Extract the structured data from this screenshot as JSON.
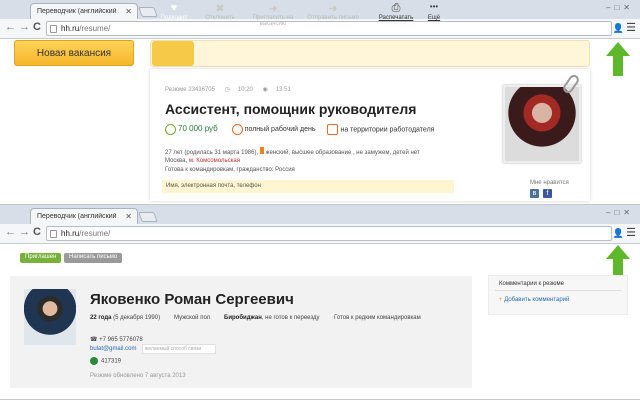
{
  "browser": {
    "tab_title": "Переводчик (английский я",
    "tab_close": "✕",
    "window_controls": "–□✕",
    "url_host": "hh.ru",
    "url_path": "/resume/",
    "back": "←",
    "forward": "→",
    "reload": "C",
    "ext_icon": "👤",
    "menu": "☰"
  },
  "colors": {
    "arrow": "#5fb82c",
    "brand": "#f5b72a",
    "success": "#2a7a3a"
  },
  "window1": {
    "new_vacancy": "Новая вакансия",
    "actions": [
      {
        "icon": "heart-icon",
        "glyph": "♥",
        "label": "Подходит"
      },
      {
        "icon": "close-icon",
        "glyph": "✖",
        "label": "Отклонить"
      },
      {
        "icon": "arrow-right-icon",
        "glyph": "➜",
        "label": "Пригласить на вакансию"
      },
      {
        "icon": "arrow-right-icon",
        "glyph": "➜",
        "label": "Отправить письмо"
      },
      {
        "icon": "printer-icon",
        "glyph": "⎙",
        "label": "Распечатать"
      },
      {
        "icon": "more-icon",
        "glyph": "•••",
        "label": "Ещё"
      }
    ],
    "meta": {
      "resume": "Резюме 23436705",
      "time": "10:20",
      "views": "13:51"
    },
    "title": "Ассистент, помощник руководителя",
    "salary": "70 000 руб",
    "schedule": "полный рабочий день",
    "location": "на территории работодателя",
    "personal": "27 лет (родилась 31 марта 1986),",
    "personal_rest": "женский, высшее образование , не замужем, детей нет",
    "city": "Москва",
    "metro": "м. Комсомольская",
    "travel": "Готова к командировкам, гражданство: Россия",
    "contact": "Имя, электронная почта, телефон",
    "likes": "Мне нравится",
    "vk": "в",
    "fb": "f"
  },
  "window2": {
    "pill1": "Приглашен",
    "pill2": "Написать письмо",
    "name": "Яковенко Роман Сергеевич",
    "age": "22 года",
    "birth": "(5 декабря 1990)",
    "sex": "Мужской пол",
    "city": "Биробиджан",
    "relocation": ", не готов к переезду",
    "travel": "Готов к редким командировкам",
    "phone": "+7 965 5776078",
    "email": "bulat@gmail.com",
    "email_hint": "желаемый способ связи",
    "skype": "417319",
    "updated": "Резюме обновлено 7 августа 2013",
    "comments_title": "Комментарии к резюме",
    "add_comment": "Добавить комментарий"
  }
}
